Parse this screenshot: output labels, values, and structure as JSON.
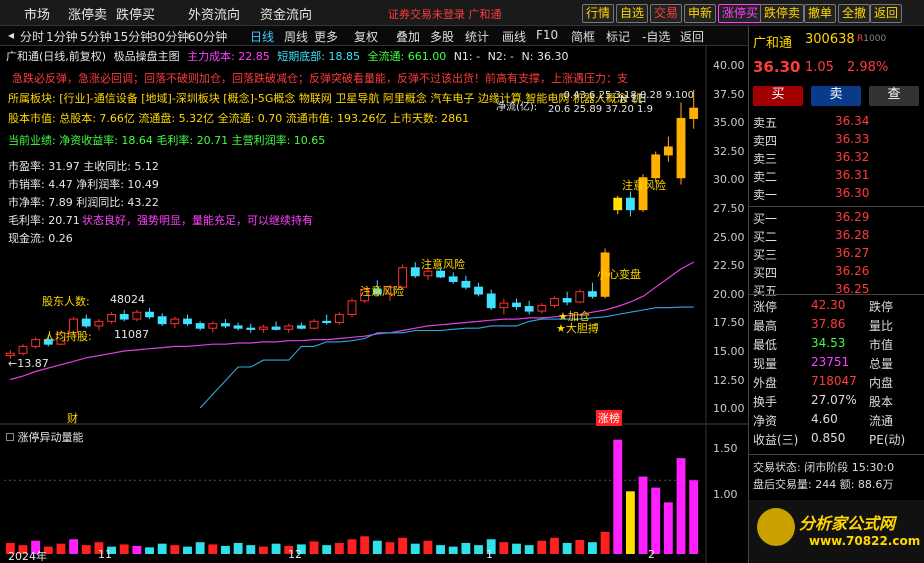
{
  "top_menu": [
    "市场",
    "涨停卖",
    "跌停买",
    "外资流向",
    "资金流向"
  ],
  "top_status": "证券交易未登录   广和通",
  "top_buttons": [
    {
      "label": "行情",
      "color": "#ffd700"
    },
    {
      "label": "自选",
      "color": "#ffd700"
    },
    {
      "label": "交易",
      "color": "#ff4040"
    },
    {
      "label": "申新",
      "color": "#ffd700"
    },
    {
      "label": "涨停买",
      "color": "#ff40ff"
    },
    {
      "label": "跌停卖",
      "color": "#ffd700"
    },
    {
      "label": "撤单",
      "color": "#ffd700"
    },
    {
      "label": "全撤",
      "color": "#ffd700"
    },
    {
      "label": "返回",
      "color": "#ffd700"
    }
  ],
  "period_bar": [
    "分时",
    "1分钟",
    "5分钟",
    "15分钟",
    "30分钟",
    "60分钟",
    "日线",
    "周线",
    "更多",
    "复权",
    "叠加",
    "多股",
    "统计",
    "画线",
    "F10",
    "简框",
    "标记",
    "-自选",
    "返回"
  ],
  "period_active": "日线",
  "indicator_line": {
    "name": "广和通(日线,前复权)",
    "main": "极品操盘主图",
    "cost": "主力成本: 22.85",
    "short_bottom": "短期底部: 18.85",
    "full_flow": "全流通: 661.00",
    "n1": "N1: -",
    "n2": "N2: -",
    "n": "N: 36.30"
  },
  "warn_line": "急跌必反弹，急涨必回调；回落不破则加仓，回落跌破减仓；反弹突破看量能，反弹不过该出货！前高有支撑，上涨遇压力：支",
  "sector_line": "所属板块: [行业]-通信设备 [地域]-深圳板块 [概念]-5G概念 物联网 卫星导航 阿里概念 汽车电子 边缘计算 智能电网 机器人概念 机",
  "capital_line": {
    "prefix": "股本市值: 总股本: 7.66亿  流通盘: 5.32亿  全流通: 0.70  流通市值: 193.26亿  上市天数: 2861",
    "flow_label": "净流(亿):",
    "flow_values": "-0.43  6.25  3.18  0.28  9.100",
    "flow_dates": "20.6  25.89  37.20  1.9"
  },
  "perf_line": "当前业绩: 净资收益率: 18.64  毛利率: 20.71  主营利润率: 10.65",
  "fundamentals": [
    "市盈率: 31.97  主收同比: 5.12",
    "市销率: 4.47  净利润率: 10.49",
    "市净率: 7.89  利润同比: 43.22",
    "毛利率: 20.71",
    "现金流: 0.26"
  ],
  "comment": "状态良好，强势明显，量能充足，可以继续持有",
  "annotations": {
    "holders": "股东人数:",
    "holders_value": "48024",
    "per_capita": "人均持股:",
    "per_capita_value": "11087",
    "low_mark": "13.87",
    "risk1": "注意风险",
    "risk2": "注意风险",
    "risk3": "注意风险",
    "change": "小心变盘",
    "add": "★加仓",
    "big": "★大胆搏",
    "cai": "财",
    "limit": "涨榜",
    "n_label": "N 1日"
  },
  "price_axis": [
    "40.00",
    "37.50",
    "35.00",
    "32.50",
    "30.00",
    "27.50",
    "25.00",
    "22.50",
    "20.00",
    "17.50",
    "15.00",
    "12.50",
    "10.00"
  ],
  "volume_axis": [
    "1.50",
    "1.00"
  ],
  "volume_title": "涨停异动量能",
  "x_axis": [
    "2024年",
    "11",
    "12",
    "1",
    "2"
  ],
  "quote": {
    "name": "广和通",
    "code": "300638",
    "badge": "R",
    "price": "36.30",
    "change": "1.05",
    "pct": "2.98%",
    "buy_btn": "买",
    "sell_btn": "卖",
    "check_btn": "查",
    "asks": [
      {
        "label": "卖五",
        "price": "36.34"
      },
      {
        "label": "卖四",
        "price": "36.33"
      },
      {
        "label": "卖三",
        "price": "36.32"
      },
      {
        "label": "卖二",
        "price": "36.31"
      },
      {
        "label": "卖一",
        "price": "36.30"
      }
    ],
    "bids": [
      {
        "label": "买一",
        "price": "36.29"
      },
      {
        "label": "买二",
        "price": "36.28"
      },
      {
        "label": "买三",
        "price": "36.27"
      },
      {
        "label": "买四",
        "price": "36.26"
      },
      {
        "label": "买五",
        "price": "36.25"
      }
    ],
    "stats": [
      {
        "l1": "涨停",
        "v1": "42.30",
        "l2": "跌停",
        "v2": ""
      },
      {
        "l1": "最高",
        "v1": "37.86",
        "l2": "量比",
        "v2": ""
      },
      {
        "l1": "最低",
        "v1": "34.53",
        "l2": "市值",
        "v2": ""
      },
      {
        "l1": "现量",
        "v1": "23751",
        "l2": "总量",
        "v2": ""
      },
      {
        "l1": "外盘",
        "v1": "718047",
        "l2": "内盘",
        "v2": ""
      },
      {
        "l1": "换手",
        "v1": "27.07%",
        "l2": "股本",
        "v2": ""
      },
      {
        "l1": "净资",
        "v1": "4.60",
        "l2": "流通",
        "v2": ""
      },
      {
        "l1": "收益(三)",
        "v1": "0.850",
        "l2": "PE(动)",
        "v2": ""
      }
    ],
    "trade_state": "交易状态: 闭市阶段 15:30:0",
    "after_volume": "盘后交易量: 244  额: 88.6万",
    "logo_text": "分析家公式网",
    "logo_url": "www.70822.com"
  },
  "chart_data": {
    "type": "candlestick",
    "y_range": [
      10,
      40
    ],
    "candles": [
      [
        14.6,
        15.1,
        14.3,
        14.8
      ],
      [
        14.8,
        15.6,
        14.6,
        15.4
      ],
      [
        15.4,
        16.2,
        15.2,
        16.0
      ],
      [
        16.0,
        16.4,
        15.4,
        15.6
      ],
      [
        15.6,
        16.8,
        15.5,
        16.6
      ],
      [
        16.6,
        18.0,
        16.4,
        17.8
      ],
      [
        17.8,
        18.2,
        17.0,
        17.2
      ],
      [
        17.2,
        17.8,
        16.8,
        17.6
      ],
      [
        17.6,
        18.4,
        17.4,
        18.2
      ],
      [
        18.2,
        18.6,
        17.6,
        17.8
      ],
      [
        17.8,
        18.6,
        17.6,
        18.4
      ],
      [
        18.4,
        18.8,
        17.8,
        18.0
      ],
      [
        18.0,
        18.3,
        17.2,
        17.4
      ],
      [
        17.4,
        18.0,
        17.0,
        17.8
      ],
      [
        17.8,
        18.2,
        17.2,
        17.4
      ],
      [
        17.4,
        17.6,
        16.8,
        17.0
      ],
      [
        17.0,
        17.6,
        16.6,
        17.4
      ],
      [
        17.4,
        17.8,
        17.0,
        17.2
      ],
      [
        17.2,
        17.5,
        16.8,
        17.0
      ],
      [
        17.0,
        17.4,
        16.6,
        16.9
      ],
      [
        16.9,
        17.3,
        16.6,
        17.1
      ],
      [
        17.1,
        17.6,
        16.8,
        16.9
      ],
      [
        16.9,
        17.4,
        16.6,
        17.2
      ],
      [
        17.2,
        17.5,
        16.9,
        17.0
      ],
      [
        17.0,
        17.8,
        16.9,
        17.6
      ],
      [
        17.6,
        18.2,
        17.3,
        17.5
      ],
      [
        17.5,
        18.4,
        17.3,
        18.2
      ],
      [
        18.2,
        19.6,
        18.0,
        19.4
      ],
      [
        19.4,
        20.6,
        19.2,
        20.4
      ],
      [
        20.4,
        21.2,
        19.8,
        20.0
      ],
      [
        20.0,
        20.8,
        19.4,
        20.6
      ],
      [
        20.6,
        22.6,
        20.4,
        22.3
      ],
      [
        22.3,
        22.8,
        21.4,
        21.6
      ],
      [
        21.6,
        22.4,
        21.2,
        22.0
      ],
      [
        22.0,
        22.3,
        21.4,
        21.5
      ],
      [
        21.5,
        21.9,
        20.9,
        21.1
      ],
      [
        21.1,
        21.6,
        20.4,
        20.6
      ],
      [
        20.6,
        21.0,
        19.8,
        20.0
      ],
      [
        20.0,
        20.4,
        18.6,
        18.8
      ],
      [
        18.8,
        19.6,
        18.2,
        19.2
      ],
      [
        19.2,
        19.6,
        18.6,
        18.9
      ],
      [
        18.9,
        19.4,
        18.2,
        18.5
      ],
      [
        18.5,
        19.2,
        18.3,
        19.0
      ],
      [
        19.0,
        19.8,
        18.8,
        19.6
      ],
      [
        19.6,
        20.2,
        19.0,
        19.3
      ],
      [
        19.3,
        20.4,
        19.2,
        20.2
      ],
      [
        20.2,
        21.0,
        19.6,
        19.8
      ],
      [
        19.8,
        24.0,
        19.6,
        23.6
      ],
      [
        27.4,
        28.6,
        27.0,
        28.4
      ],
      [
        28.4,
        29.0,
        26.8,
        27.4
      ],
      [
        27.4,
        30.5,
        27.2,
        30.2
      ],
      [
        30.2,
        32.5,
        29.8,
        32.2
      ],
      [
        32.2,
        33.8,
        31.6,
        32.9
      ],
      [
        30.2,
        36.8,
        29.6,
        35.4
      ],
      [
        35.4,
        37.9,
        34.5,
        36.3
      ]
    ],
    "ma_cost": [
      12.5,
      12.8,
      13.2,
      13.5,
      13.8,
      14.1,
      14.4,
      14.6,
      14.8,
      15.0,
      15.1,
      15.2,
      15.3,
      15.4,
      15.4,
      15.5,
      15.6,
      15.6,
      15.7,
      15.7,
      15.8,
      15.8,
      15.9,
      15.9,
      16.0,
      16.0,
      16.1,
      16.2,
      16.3,
      16.5,
      16.6,
      16.8,
      17.0,
      17.2,
      17.3,
      17.4,
      17.5,
      17.6,
      17.7,
      17.8,
      17.8,
      17.9,
      17.9,
      18.0,
      18.1,
      18.2,
      18.4,
      18.6,
      18.9,
      19.3,
      19.8,
      20.6,
      21.4,
      22.2,
      22.8
    ],
    "support": [
      null,
      null,
      null,
      null,
      null,
      null,
      null,
      null,
      null,
      null,
      null,
      null,
      null,
      null,
      null,
      10.0,
      11.2,
      12.4,
      13.6,
      13.6,
      14.2,
      14.2,
      14.2,
      15.4,
      15.4,
      15.8,
      15.8,
      15.9,
      16.1,
      16.6,
      16.6,
      16.6,
      16.8,
      16.8,
      16.8,
      16.9,
      17.0,
      17.0,
      17.2,
      17.2,
      17.2,
      17.6,
      17.8,
      17.8,
      17.8,
      17.8,
      17.9,
      18.0,
      18.2,
      18.4,
      18.6,
      18.8,
      18.8,
      18.85,
      18.85
    ],
    "volume": [
      0.15,
      0.12,
      0.18,
      0.1,
      0.14,
      0.2,
      0.12,
      0.16,
      0.1,
      0.13,
      0.11,
      0.09,
      0.14,
      0.12,
      0.1,
      0.16,
      0.13,
      0.11,
      0.15,
      0.12,
      0.1,
      0.14,
      0.11,
      0.13,
      0.17,
      0.12,
      0.15,
      0.2,
      0.24,
      0.18,
      0.16,
      0.22,
      0.14,
      0.18,
      0.12,
      0.1,
      0.15,
      0.12,
      0.2,
      0.16,
      0.14,
      0.12,
      0.18,
      0.22,
      0.15,
      0.19,
      0.16,
      0.3,
      1.55,
      0.85,
      1.05,
      0.9,
      0.7,
      1.3,
      1.0
    ],
    "volume_colors": [
      "red",
      "red",
      "magenta",
      "red",
      "red",
      "magenta",
      "red",
      "red",
      "cyan",
      "red",
      "magenta",
      "cyan",
      "cyan",
      "red",
      "cyan",
      "cyan",
      "red",
      "cyan",
      "cyan",
      "cyan",
      "red",
      "cyan",
      "red",
      "cyan",
      "red",
      "cyan",
      "red",
      "red",
      "red",
      "cyan",
      "red",
      "red",
      "cyan",
      "red",
      "cyan",
      "cyan",
      "cyan",
      "cyan",
      "cyan",
      "red",
      "cyan",
      "cyan",
      "red",
      "red",
      "cyan",
      "red",
      "cyan",
      "red",
      "magenta",
      "yellow",
      "magenta",
      "magenta",
      "magenta",
      "magenta",
      "magenta"
    ]
  }
}
